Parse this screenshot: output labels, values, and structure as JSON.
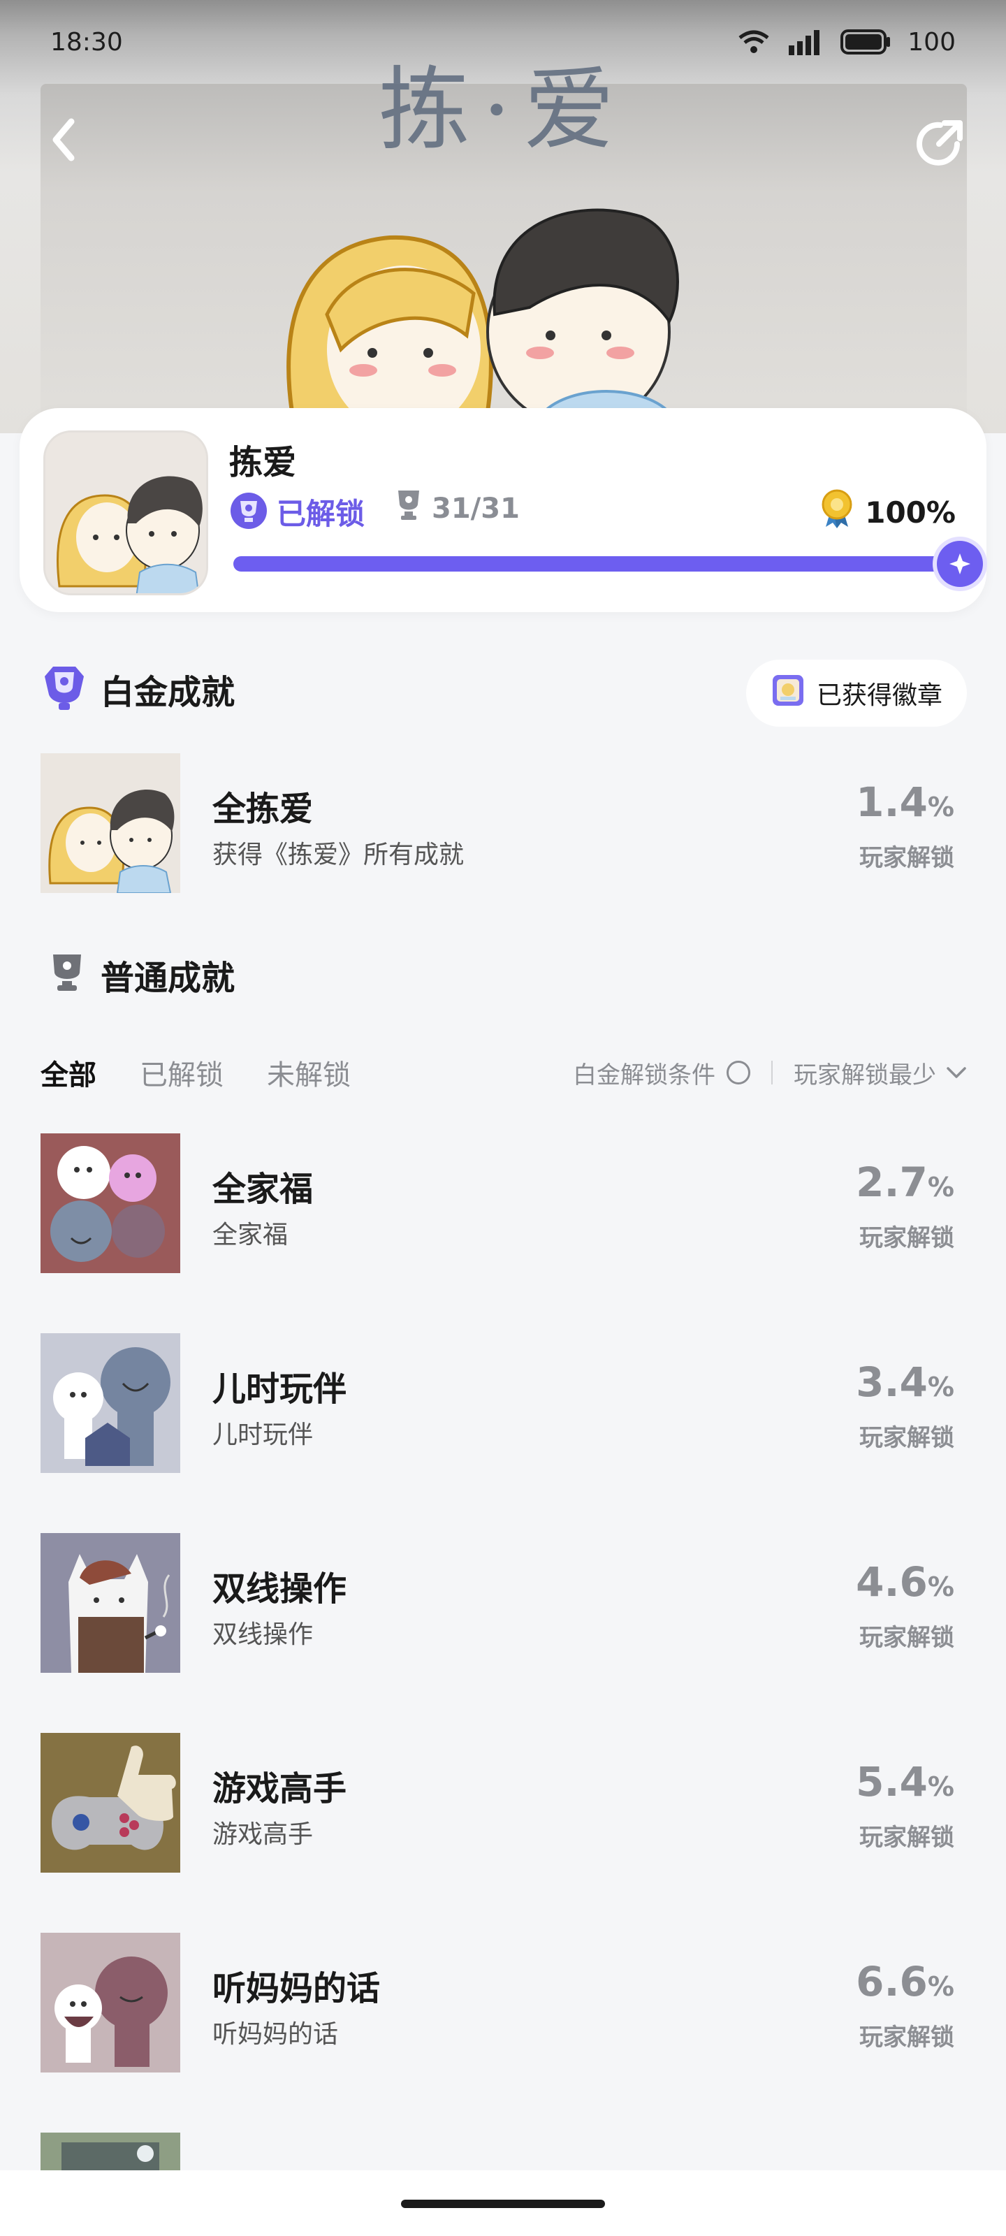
{
  "status_bar": {
    "time": "18:30",
    "battery": "100",
    "network": "5G"
  },
  "hero": {
    "title": "拣·爱"
  },
  "game": {
    "name": "拣爱",
    "unlocked_label": "已解锁",
    "trophies": "31/31",
    "percent": "100%",
    "progress_fraction": 1.0
  },
  "platinum": {
    "section_title": "白金成就",
    "badge_button": "已获得徽章",
    "item": {
      "title": "全拣爱",
      "desc": "获得《拣爱》所有成就",
      "pct": "1.4",
      "pct_unit": "%",
      "sub": "玩家解锁"
    }
  },
  "normal": {
    "section_title": "普通成就",
    "tabs": [
      "全部",
      "已解锁",
      "未解锁"
    ],
    "filter_condition": "白金解锁条件",
    "sort_label": "玩家解锁最少",
    "items": [
      {
        "title": "全家福",
        "desc": "全家福",
        "pct": "2.7",
        "pct_unit": "%",
        "sub": "玩家解锁"
      },
      {
        "title": "儿时玩伴",
        "desc": "儿时玩伴",
        "pct": "3.4",
        "pct_unit": "%",
        "sub": "玩家解锁"
      },
      {
        "title": "双线操作",
        "desc": "双线操作",
        "pct": "4.6",
        "pct_unit": "%",
        "sub": "玩家解锁"
      },
      {
        "title": "游戏高手",
        "desc": "游戏高手",
        "pct": "5.4",
        "pct_unit": "%",
        "sub": "玩家解锁"
      },
      {
        "title": "听妈妈的话",
        "desc": "听妈妈的话",
        "pct": "6.6",
        "pct_unit": "%",
        "sub": "玩家解锁"
      }
    ]
  },
  "colors": {
    "accent": "#6d5ef0",
    "muted": "#8c8e93",
    "background": "#f5f6f8"
  }
}
